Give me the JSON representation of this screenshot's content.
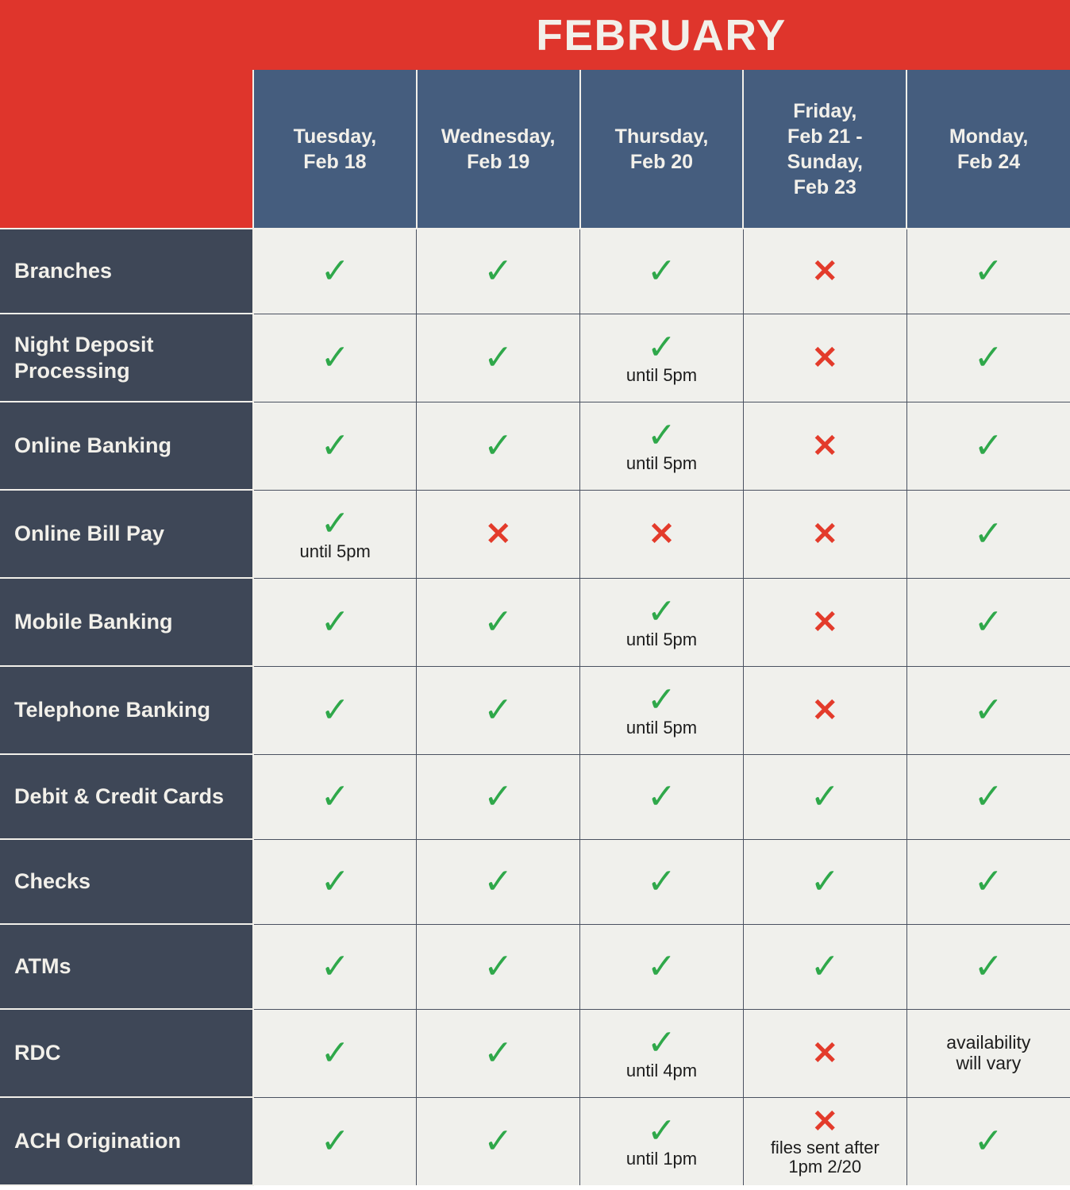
{
  "header": {
    "month_title": "FEBRUARY",
    "corner_label": ""
  },
  "colors": {
    "banner_red": "#df352c",
    "header_blue": "#455d7e",
    "row_label_slate": "#3e4757",
    "cell_background": "#f0f0ec",
    "check_green": "#2fa84a",
    "cross_red": "#e33b2b",
    "text_cream": "#f2f0ea"
  },
  "columns": [
    {
      "label": "Tuesday,\nFeb 18"
    },
    {
      "label": "Wednesday,\nFeb 19"
    },
    {
      "label": "Thursday,\nFeb 20"
    },
    {
      "label": "Friday,\nFeb 21 -\nSunday,\nFeb 23"
    },
    {
      "label": "Monday,\nFeb 24"
    }
  ],
  "glyphs": {
    "check": "✓",
    "cross": "✕"
  },
  "rows": [
    {
      "label": "Branches",
      "cells": [
        {
          "mark": "check",
          "note": ""
        },
        {
          "mark": "check",
          "note": ""
        },
        {
          "mark": "check",
          "note": ""
        },
        {
          "mark": "cross",
          "note": ""
        },
        {
          "mark": "check",
          "note": ""
        }
      ]
    },
    {
      "label": "Night Deposit Processing",
      "cells": [
        {
          "mark": "check",
          "note": ""
        },
        {
          "mark": "check",
          "note": ""
        },
        {
          "mark": "check",
          "note": "until 5pm"
        },
        {
          "mark": "cross",
          "note": ""
        },
        {
          "mark": "check",
          "note": ""
        }
      ]
    },
    {
      "label": "Online Banking",
      "cells": [
        {
          "mark": "check",
          "note": ""
        },
        {
          "mark": "check",
          "note": ""
        },
        {
          "mark": "check",
          "note": "until 5pm"
        },
        {
          "mark": "cross",
          "note": ""
        },
        {
          "mark": "check",
          "note": ""
        }
      ]
    },
    {
      "label": "Online Bill Pay",
      "cells": [
        {
          "mark": "check",
          "note": "until 5pm"
        },
        {
          "mark": "cross",
          "note": ""
        },
        {
          "mark": "cross",
          "note": ""
        },
        {
          "mark": "cross",
          "note": ""
        },
        {
          "mark": "check",
          "note": ""
        }
      ]
    },
    {
      "label": "Mobile Banking",
      "cells": [
        {
          "mark": "check",
          "note": ""
        },
        {
          "mark": "check",
          "note": ""
        },
        {
          "mark": "check",
          "note": "until 5pm"
        },
        {
          "mark": "cross",
          "note": ""
        },
        {
          "mark": "check",
          "note": ""
        }
      ]
    },
    {
      "label": "Telephone Banking",
      "cells": [
        {
          "mark": "check",
          "note": ""
        },
        {
          "mark": "check",
          "note": ""
        },
        {
          "mark": "check",
          "note": "until 5pm"
        },
        {
          "mark": "cross",
          "note": ""
        },
        {
          "mark": "check",
          "note": ""
        }
      ]
    },
    {
      "label": "Debit & Credit Cards",
      "cells": [
        {
          "mark": "check",
          "note": ""
        },
        {
          "mark": "check",
          "note": ""
        },
        {
          "mark": "check",
          "note": ""
        },
        {
          "mark": "check",
          "note": ""
        },
        {
          "mark": "check",
          "note": ""
        }
      ]
    },
    {
      "label": "Checks",
      "cells": [
        {
          "mark": "check",
          "note": ""
        },
        {
          "mark": "check",
          "note": ""
        },
        {
          "mark": "check",
          "note": ""
        },
        {
          "mark": "check",
          "note": ""
        },
        {
          "mark": "check",
          "note": ""
        }
      ]
    },
    {
      "label": "ATMs",
      "cells": [
        {
          "mark": "check",
          "note": ""
        },
        {
          "mark": "check",
          "note": ""
        },
        {
          "mark": "check",
          "note": ""
        },
        {
          "mark": "check",
          "note": ""
        },
        {
          "mark": "check",
          "note": ""
        }
      ]
    },
    {
      "label": "RDC",
      "cells": [
        {
          "mark": "check",
          "note": ""
        },
        {
          "mark": "check",
          "note": ""
        },
        {
          "mark": "check",
          "note": "until 4pm"
        },
        {
          "mark": "cross",
          "note": ""
        },
        {
          "mark": "none",
          "note": "availability\nwill vary"
        }
      ]
    },
    {
      "label": "ACH Origination",
      "cells": [
        {
          "mark": "check",
          "note": ""
        },
        {
          "mark": "check",
          "note": ""
        },
        {
          "mark": "check",
          "note": "until 1pm"
        },
        {
          "mark": "cross",
          "note": "files sent after\n1pm 2/20"
        },
        {
          "mark": "check",
          "note": ""
        }
      ]
    }
  ]
}
